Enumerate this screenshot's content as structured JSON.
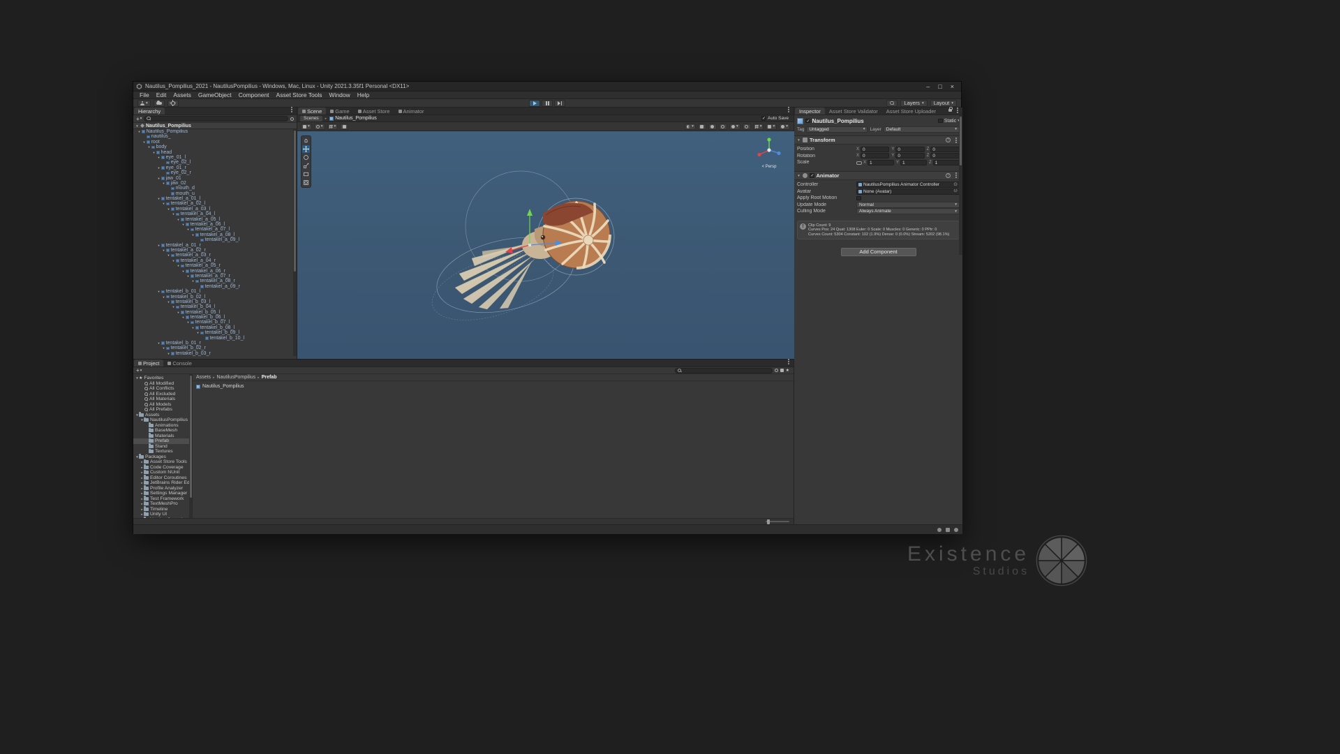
{
  "watermark": {
    "line1": "Existence",
    "line2": "Studios"
  },
  "titlebar": {
    "title": "Nautilus_Pompilius_2021 - NautilusPompilius - Windows, Mac, Linux - Unity 2021.3.35f1 Personal <DX11>",
    "window_buttons": {
      "minimize": "–",
      "maximize": "□",
      "close": "×"
    }
  },
  "menubar": {
    "items": [
      "File",
      "Edit",
      "Assets",
      "GameObject",
      "Component",
      "Asset Store Tools",
      "Window",
      "Help"
    ]
  },
  "toolbar": {
    "layers": "Layers",
    "layout": "Layout"
  },
  "hierarchy": {
    "tab": "Hierarchy",
    "scene_name": "Nautilus_Pompilius",
    "items": [
      {
        "label": "Nautilus_Pompilius",
        "level": 0,
        "children": true
      },
      {
        "label": "nautilus_",
        "level": 1,
        "children": false
      },
      {
        "label": "root",
        "level": 1,
        "children": true
      },
      {
        "label": "body",
        "level": 2,
        "children": true
      },
      {
        "label": "head",
        "level": 3,
        "children": true
      },
      {
        "label": "eye_01_l",
        "level": 4,
        "children": true
      },
      {
        "label": "eye_02_l",
        "level": 5,
        "children": false
      },
      {
        "label": "eye_01_r",
        "level": 4,
        "children": true
      },
      {
        "label": "eye_02_r",
        "level": 5,
        "children": false
      },
      {
        "label": "jaw_01",
        "level": 4,
        "children": true
      },
      {
        "label": "jaw_02",
        "level": 5,
        "children": true
      },
      {
        "label": "mouth_d",
        "level": 6,
        "children": false
      },
      {
        "label": "mouth_u",
        "level": 6,
        "children": false
      },
      {
        "label": "tentakel_a_01_l",
        "level": 4,
        "children": true
      },
      {
        "label": "tentakel_a_02_l",
        "level": 5,
        "children": true
      },
      {
        "label": "tentakel_a_03_l",
        "level": 6,
        "children": true
      },
      {
        "label": "tentakel_a_04_l",
        "level": 7,
        "children": true
      },
      {
        "label": "tentakel_a_05_l",
        "level": 8,
        "children": true
      },
      {
        "label": "tentakel_a_06_l",
        "level": 9,
        "children": true
      },
      {
        "label": "tentakel_a_07_l",
        "level": 10,
        "children": true
      },
      {
        "label": "tentakel_a_08_l",
        "level": 11,
        "children": true
      },
      {
        "label": "tentakel_a_09_l",
        "level": 12,
        "children": false
      },
      {
        "label": "tentakel_a_01_r",
        "level": 4,
        "children": true
      },
      {
        "label": "tentakel_a_02_r",
        "level": 5,
        "children": true
      },
      {
        "label": "tentakel_a_03_r",
        "level": 6,
        "children": true
      },
      {
        "label": "tentakel_a_04_r",
        "level": 7,
        "children": true
      },
      {
        "label": "tentakel_a_05_r",
        "level": 8,
        "children": true
      },
      {
        "label": "tentakel_a_06_r",
        "level": 9,
        "children": true
      },
      {
        "label": "tentakel_a_07_r",
        "level": 10,
        "children": true
      },
      {
        "label": "tentakel_a_08_r",
        "level": 11,
        "children": true
      },
      {
        "label": "tentakel_a_09_r",
        "level": 12,
        "children": false
      },
      {
        "label": "tentakel_b_01_l",
        "level": 4,
        "children": true
      },
      {
        "label": "tentakel_b_02_l",
        "level": 5,
        "children": true
      },
      {
        "label": "tentakel_b_03_l",
        "level": 6,
        "children": true
      },
      {
        "label": "tentakel_b_04_l",
        "level": 7,
        "children": true
      },
      {
        "label": "tentakel_b_05_l",
        "level": 8,
        "children": true
      },
      {
        "label": "tentakel_b_06_l",
        "level": 9,
        "children": true
      },
      {
        "label": "tentakel_b_07_l",
        "level": 10,
        "children": true
      },
      {
        "label": "tentakel_b_08_l",
        "level": 11,
        "children": true
      },
      {
        "label": "tentakel_b_09_l",
        "level": 12,
        "children": true
      },
      {
        "label": "tentakel_b_10_l",
        "level": 13,
        "children": false
      },
      {
        "label": "tentakel_b_01_r",
        "level": 4,
        "children": true
      },
      {
        "label": "tentakel_b_02_r",
        "level": 5,
        "children": true
      },
      {
        "label": "tentakel_b_03_r",
        "level": 6,
        "children": true
      }
    ]
  },
  "scene_view": {
    "tabs": [
      "Scene",
      "Game",
      "Asset Store",
      "Animator"
    ],
    "active_tab": "Scene",
    "breadcrumb": {
      "scenes": "Scenes",
      "current": "Nautilus_Pompilius"
    },
    "auto_save": "Auto Save",
    "camera_label": "Persp"
  },
  "inspector": {
    "tabs": [
      "Inspector",
      "Asset Store Validator",
      "Asset Store Uploader"
    ],
    "active_tab": "Inspector",
    "header": {
      "name": "Nautilus_Pompilius",
      "static_label": "Static"
    },
    "tag_row": {
      "tag_label": "Tag",
      "tag_value": "Untagged",
      "layer_label": "Layer",
      "layer_value": "Default"
    },
    "transform": {
      "title": "Transform",
      "axis_labels": [
        "X",
        "Y",
        "Z"
      ],
      "rows": [
        {
          "label": "Position",
          "x": "0",
          "y": "0",
          "z": "0",
          "linked": false
        },
        {
          "label": "Rotation",
          "x": "0",
          "y": "0",
          "z": "0",
          "linked": false
        },
        {
          "label": "Scale",
          "x": "1",
          "y": "1",
          "z": "1",
          "linked": true
        }
      ]
    },
    "animator": {
      "title": "Animator",
      "fields": [
        {
          "label": "Controller",
          "value": "NautilusPompilius Animator Controller",
          "type": "object"
        },
        {
          "label": "Avatar",
          "value": "None (Avatar)",
          "type": "object"
        },
        {
          "label": "Apply Root Motion",
          "type": "checkbox",
          "checked": false
        },
        {
          "label": "Update Mode",
          "value": "Normal",
          "type": "dropdown"
        },
        {
          "label": "Culling Mode",
          "value": "Always Animate",
          "type": "dropdown"
        }
      ],
      "info_lines": [
        "Clip Count: 9",
        "Curves Pos: 24 Quat: 1308 Euler: 0 Scale: 0 Muscles: 0 Generic: 0 PPtr: 0",
        "Curves Count: 5304 Constant: 102 (1.9%) Dense: 0 (0.0%) Stream: 5202 (98.1%)"
      ]
    },
    "add_component_label": "Add Component"
  },
  "project": {
    "tabs": [
      "Project",
      "Console"
    ],
    "active_tab": "Project",
    "favorites": {
      "label": "Favorites",
      "items": [
        "All Modified",
        "All Conflicts",
        "All Excluded",
        "All Materials",
        "All Models",
        "All Prefabs"
      ]
    },
    "assets": {
      "label": "Assets",
      "root": "NautilusPompilius",
      "children": [
        "Animations",
        "BaseMesh",
        "Materials",
        "Prefab",
        "Stand",
        "Textures"
      ],
      "selected": "Prefab"
    },
    "packages": {
      "label": "Packages",
      "children": [
        "Asset Store Tools",
        "Code Coverage",
        "Custom NUnit",
        "Editor Coroutines",
        "JetBrains Rider Editor",
        "Profile Analyzer",
        "Settings Manager",
        "Test Framework",
        "TextMeshPro",
        "Timeline",
        "Unity UI",
        "Version Control"
      ]
    },
    "breadcrumb": [
      "Assets",
      "NautilusPompilius",
      "Prefab"
    ],
    "content_items": [
      {
        "label": "Nautilus_Pompilius",
        "type": "prefab"
      }
    ]
  }
}
